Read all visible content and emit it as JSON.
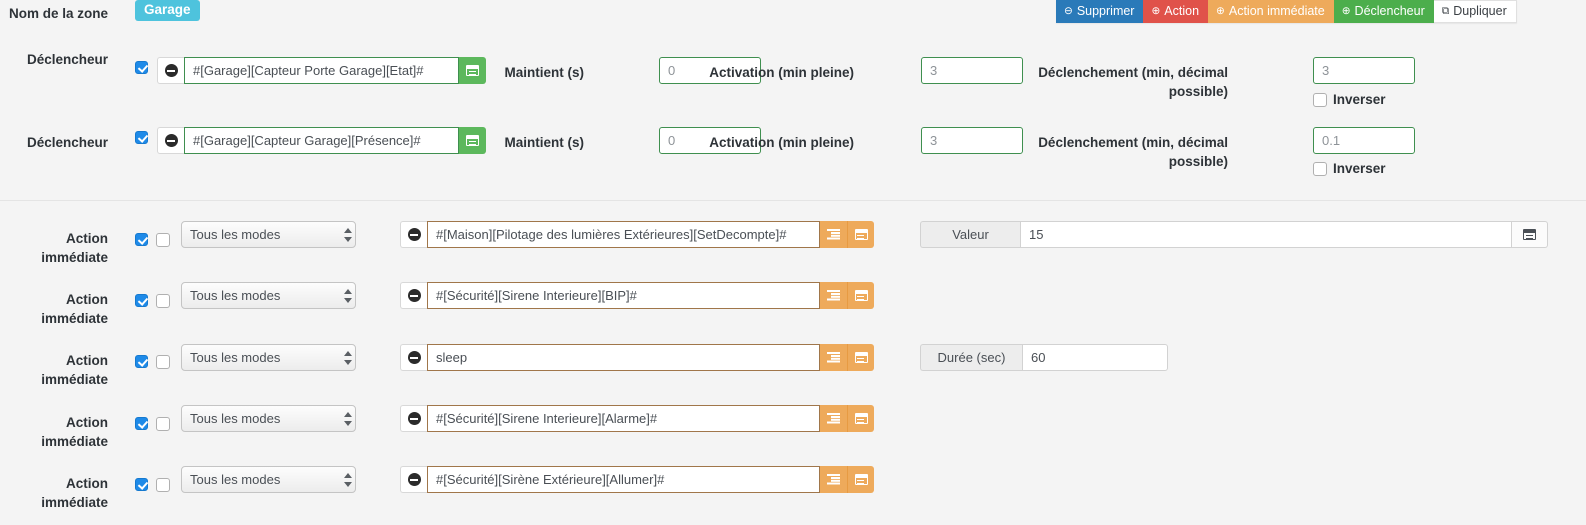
{
  "toolbar": {
    "buttons": [
      {
        "label": "Supprimer",
        "icon": "minus-circle-icon",
        "glyph": "⊖",
        "color": "#2a7ab9"
      },
      {
        "label": "Action",
        "icon": "plus-circle-icon",
        "glyph": "⊕",
        "color": "#e0524a"
      },
      {
        "label": "Action immédiate",
        "icon": "plus-circle-icon",
        "glyph": "⊕",
        "color": "#eeaa5b"
      },
      {
        "label": "Déclencheur",
        "icon": "plus-circle-icon",
        "glyph": "⊕",
        "color": "#4cae4c"
      },
      {
        "label": "Dupliquer",
        "icon": "copy-icon",
        "glyph": "⧉",
        "color": "#ffffff"
      }
    ]
  },
  "zone": {
    "label": "Nom de la zone",
    "name": "Garage",
    "badge_color": "#4ec3dd"
  },
  "triggers": [
    {
      "label": "Déclencheur",
      "enabled": true,
      "expression": "#[Garage][Capteur Porte Garage][Etat]#",
      "maintient_label": "Maintient (s)",
      "maintient_value": "0",
      "activation_label": "Activation (min pleine)",
      "activation_value": "3",
      "declenchement_label": "Déclenchement (min, décimal possible)",
      "declenchement_value": "3",
      "inverser_label": "Inverser",
      "inverser_checked": false
    },
    {
      "label": "Déclencheur",
      "enabled": true,
      "expression": "#[Garage][Capteur Garage][Présence]#",
      "maintient_label": "Maintient (s)",
      "maintient_value": "0",
      "activation_label": "Activation (min pleine)",
      "activation_value": "3",
      "declenchement_label": "Déclenchement (min, décimal possible)",
      "declenchement_value": "0.1",
      "inverser_label": "Inverser",
      "inverser_checked": false
    }
  ],
  "actions": [
    {
      "label": "Action immédiate",
      "enabled": true,
      "second_checked": false,
      "mode": "Tous les modes",
      "expression": "#[Maison][Pilotage des lumières Extérieures][SetDecompte]#",
      "extra": {
        "label": "Valeur",
        "value": "15",
        "wide": true
      }
    },
    {
      "label": "Action immédiate",
      "enabled": true,
      "second_checked": false,
      "mode": "Tous les modes",
      "expression": "#[Sécurité][Sirene Interieure][BIP]#",
      "extra": null
    },
    {
      "label": "Action immédiate",
      "enabled": true,
      "second_checked": false,
      "mode": "Tous les modes",
      "expression": "sleep",
      "extra": {
        "label": "Durée (sec)",
        "value": "60",
        "wide": false
      }
    },
    {
      "label": "Action immédiate",
      "enabled": true,
      "second_checked": false,
      "mode": "Tous les modes",
      "expression": "#[Sécurité][Sirene Interieure][Alarme]#",
      "extra": null
    },
    {
      "label": "Action immédiate",
      "enabled": true,
      "second_checked": false,
      "mode": "Tous les modes",
      "expression": "#[Sécurité][Sirène Extérieure][Allumer]#",
      "extra": null
    }
  ],
  "mode_options": [
    "Tous les modes"
  ],
  "colors": {
    "background": "#f4f4f4",
    "trigger_addon": "#5cb85c",
    "action_addon": "#eeaa5b",
    "trigger_border": "#3f8f4f",
    "action_border": "#a0764a",
    "checkbox_on": "#1e8ae8"
  }
}
